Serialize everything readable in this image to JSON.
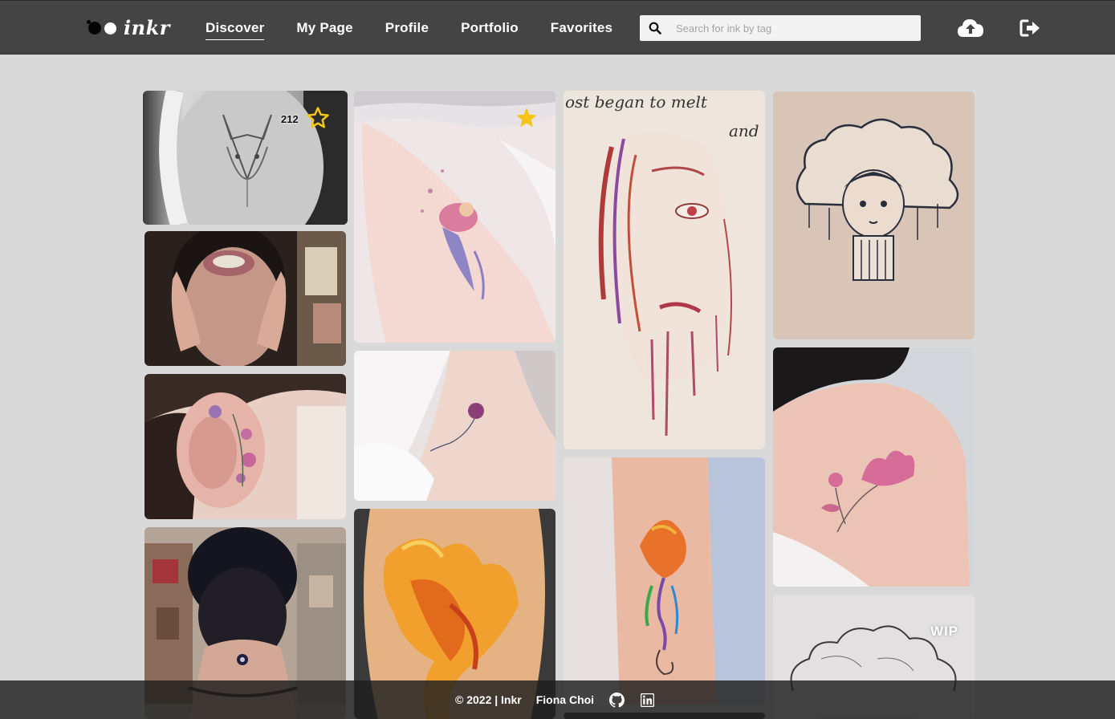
{
  "app": {
    "logo_text": "inkr"
  },
  "nav": {
    "items": [
      {
        "label": "Discover",
        "active": true
      },
      {
        "label": "My Page",
        "active": false
      },
      {
        "label": "Profile",
        "active": false
      },
      {
        "label": "Portfolio",
        "active": false
      },
      {
        "label": "Favorites",
        "active": false
      }
    ],
    "search_placeholder": "Search for ink by tag",
    "upload_icon": "cloud-upload-icon",
    "logout_icon": "sign-out-icon"
  },
  "gallery": {
    "tiles": [
      {
        "subject": "wolf tattoo",
        "favorite_count": "212",
        "star": "outline"
      },
      {
        "subject": "lip tattoo"
      },
      {
        "subject": "ear flower tattoo"
      },
      {
        "subject": "neck tattoo"
      },
      {
        "subject": "pink fairy tattoo",
        "star": "filled"
      },
      {
        "subject": "rose ankle tattoo"
      },
      {
        "subject": "phoenix tattoo"
      },
      {
        "subject": "melting face sketch",
        "sketch_text": [
          "ost began to melt",
          "and"
        ]
      },
      {
        "subject": "rainbow phoenix tattoo"
      },
      {
        "subject": "cloud girl tattoo"
      },
      {
        "subject": "lotus shoulder tattoo"
      },
      {
        "subject": "cloud sketch",
        "badge": "WIP"
      }
    ],
    "colors": {
      "star_filled": "#f5c518",
      "star_outline": "#f5c518"
    }
  },
  "footer": {
    "copyright": "© 2022 | Inkr",
    "author": "Fiona Choi",
    "github_icon": "github-icon",
    "linkedin_icon": "linkedin-icon"
  }
}
